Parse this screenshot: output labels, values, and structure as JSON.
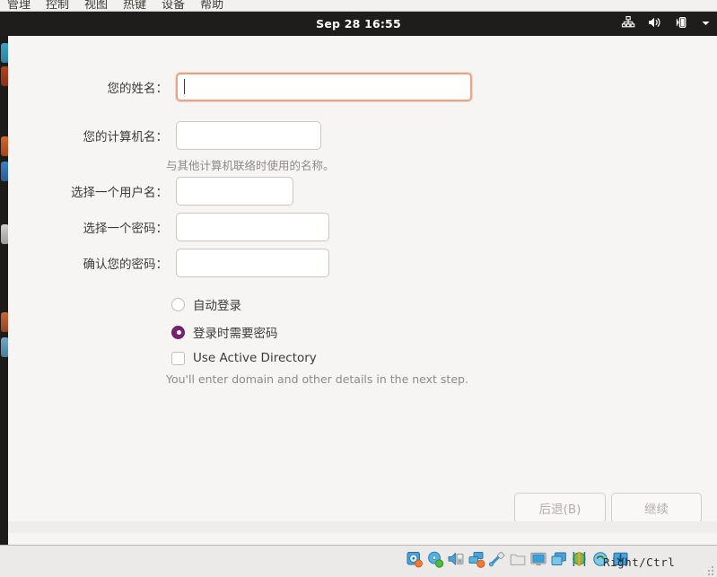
{
  "vm_menubar": {
    "items": [
      {
        "label": "管理",
        "name": "menu-manage"
      },
      {
        "label": "控制",
        "name": "menu-control"
      },
      {
        "label": "视图",
        "name": "menu-view"
      },
      {
        "label": "热键",
        "name": "menu-hotkey"
      },
      {
        "label": "设备",
        "name": "menu-device"
      },
      {
        "label": "帮助",
        "name": "menu-help"
      }
    ]
  },
  "topbar": {
    "clock": "Sep 28  16:55",
    "icons": [
      "network-wired-icon",
      "volume-icon",
      "battery-icon",
      "chevron-down-icon"
    ]
  },
  "installer": {
    "fields": [
      {
        "label": "您的姓名：",
        "value": "",
        "placeholder": "",
        "name": "your-name-field",
        "focused": true
      },
      {
        "label": "您的计算机名：",
        "value": "",
        "placeholder": "",
        "name": "computer-name-field",
        "focused": false
      },
      {
        "label": "选择一个用户名：",
        "value": "",
        "placeholder": "",
        "name": "username-field",
        "focused": false
      },
      {
        "label": "选择一个密码：",
        "value": "",
        "placeholder": "",
        "name": "password-field",
        "focused": false
      },
      {
        "label": "确认您的密码：",
        "value": "",
        "placeholder": "",
        "name": "confirm-password-field",
        "focused": false
      }
    ],
    "computer_name_hint": "与其他计算机联络时使用的名称。",
    "login_options": [
      {
        "label": "自动登录",
        "selected": false,
        "name": "auto-login-radio"
      },
      {
        "label": "登录时需要密码",
        "selected": true,
        "name": "require-password-radio"
      }
    ],
    "active_directory": {
      "label": "Use Active Directory",
      "checked": false,
      "hint": "You'll enter domain and other details in the next step."
    },
    "buttons": {
      "back": "后退(B)",
      "continue": "继续"
    }
  },
  "vm_statusbar": {
    "host_key": "Right/Ctrl",
    "device_icons": [
      "hard-disk-icon",
      "optical-disk-icon",
      "floppy-disk-icon",
      "network-adapter-icon",
      "usb-icon",
      "shared-folder-icon",
      "display-icon",
      "recording-icon",
      "features-icon",
      "mouse-integration-icon",
      "keyboard-icon"
    ]
  },
  "colors": {
    "accent_focus": "#eaa385",
    "accent_radio": "#77216f",
    "window_bg": "#f6f5f4",
    "topbar_bg": "#1f1d1c",
    "statusbar_bg": "#ebeae8"
  }
}
